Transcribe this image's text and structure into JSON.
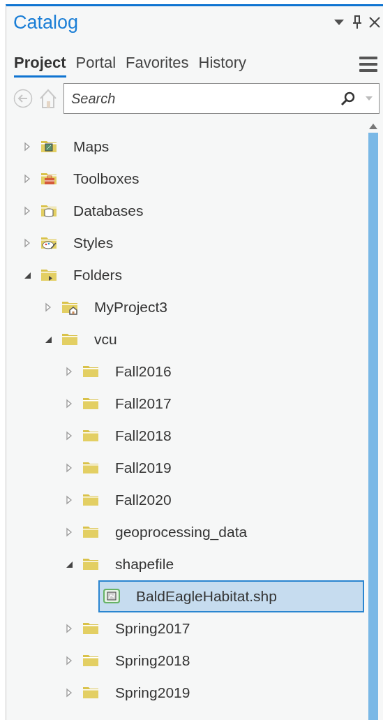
{
  "pane": {
    "title": "Catalog"
  },
  "tabs": [
    {
      "label": "Project",
      "selected": true
    },
    {
      "label": "Portal",
      "selected": false
    },
    {
      "label": "Favorites",
      "selected": false
    },
    {
      "label": "History",
      "selected": false
    }
  ],
  "search": {
    "placeholder": "Search"
  },
  "tree": [
    {
      "label": "Maps",
      "kind": "maps",
      "expanded": false,
      "selected": false
    },
    {
      "label": "Toolboxes",
      "kind": "toolboxes",
      "expanded": false,
      "selected": false
    },
    {
      "label": "Databases",
      "kind": "databases",
      "expanded": false,
      "selected": false
    },
    {
      "label": "Styles",
      "kind": "styles",
      "expanded": false,
      "selected": false
    },
    {
      "label": "Folders",
      "kind": "folders",
      "expanded": true,
      "selected": false,
      "children": [
        {
          "label": "MyProject3",
          "kind": "project_folder",
          "expanded": false,
          "selected": false
        },
        {
          "label": "vcu",
          "kind": "folder",
          "expanded": true,
          "selected": false,
          "children": [
            {
              "label": "Fall2016",
              "kind": "folder",
              "expanded": false,
              "selected": false
            },
            {
              "label": "Fall2017",
              "kind": "folder",
              "expanded": false,
              "selected": false
            },
            {
              "label": "Fall2018",
              "kind": "folder",
              "expanded": false,
              "selected": false
            },
            {
              "label": "Fall2019",
              "kind": "folder",
              "expanded": false,
              "selected": false
            },
            {
              "label": "Fall2020",
              "kind": "folder",
              "expanded": false,
              "selected": false
            },
            {
              "label": "geoprocessing_data",
              "kind": "folder",
              "expanded": false,
              "selected": false
            },
            {
              "label": "shapefile",
              "kind": "folder",
              "expanded": true,
              "selected": false,
              "children": [
                {
                  "label": "BaldEagleHabitat.shp",
                  "kind": "shapefile",
                  "selected": true
                }
              ]
            },
            {
              "label": "Spring2017",
              "kind": "folder",
              "expanded": false,
              "selected": false
            },
            {
              "label": "Spring2018",
              "kind": "folder",
              "expanded": false,
              "selected": false
            },
            {
              "label": "Spring2019",
              "kind": "folder",
              "expanded": false,
              "selected": false
            }
          ]
        }
      ]
    }
  ]
}
